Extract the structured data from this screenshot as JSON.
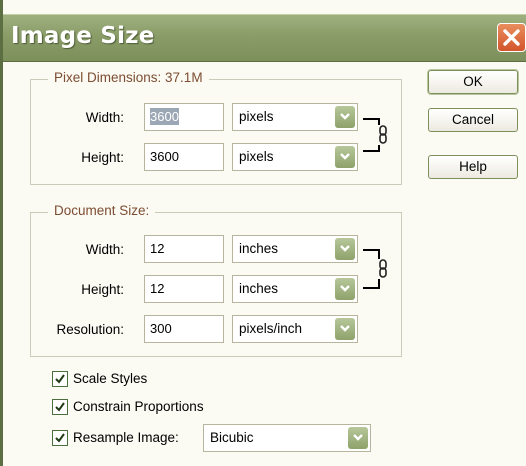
{
  "dialog": {
    "title": "Image Size",
    "buttons": {
      "ok": "OK",
      "cancel": "Cancel",
      "help": "Help"
    }
  },
  "pixel_dimensions": {
    "legend": "Pixel Dimensions:  37.1M",
    "width": {
      "label": "Width:",
      "value": "3600",
      "unit": "pixels"
    },
    "height": {
      "label": "Height:",
      "value": "3600",
      "unit": "pixels"
    }
  },
  "document_size": {
    "legend": "Document Size:",
    "width": {
      "label": "Width:",
      "value": "12",
      "unit": "inches"
    },
    "height": {
      "label": "Height:",
      "value": "12",
      "unit": "inches"
    },
    "resolution": {
      "label": "Resolution:",
      "value": "300",
      "unit": "pixels/inch"
    }
  },
  "options": {
    "scale_styles": {
      "label": "Scale Styles",
      "checked": true
    },
    "constrain_proportions": {
      "label": "Constrain Proportions",
      "checked": true
    },
    "resample_image": {
      "label": "Resample Image:",
      "checked": true,
      "method": "Bicubic"
    }
  },
  "colors": {
    "titlebar": "#8a9d68",
    "accent_green": "#8ea26b",
    "close_button": "#d3552b",
    "legend_text": "#7d4d32"
  },
  "icons": [
    "close-icon",
    "chevron-down-icon",
    "chain-link-icon",
    "checkmark-icon"
  ]
}
